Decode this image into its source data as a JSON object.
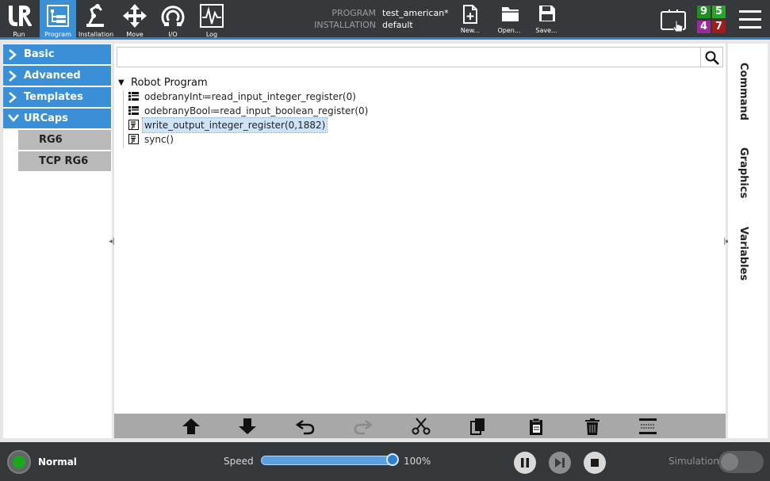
{
  "topbar": {
    "nav": [
      {
        "id": "run",
        "label": "Run",
        "icon": "ur-logo-icon",
        "active": false
      },
      {
        "id": "program",
        "label": "Program",
        "icon": "program-tree-icon",
        "active": true
      },
      {
        "id": "installation",
        "label": "Installation",
        "icon": "robot-arm-icon",
        "active": false
      },
      {
        "id": "move",
        "label": "Move",
        "icon": "move-arrows-icon",
        "active": false
      },
      {
        "id": "io",
        "label": "I/O",
        "icon": "io-dial-icon",
        "active": false
      },
      {
        "id": "log",
        "label": "Log",
        "icon": "log-chart-icon",
        "active": false
      }
    ],
    "program_label": "PROGRAM",
    "program_value": "test_american*",
    "installation_label": "INSTALLATION",
    "installation_value": "default",
    "file_buttons": [
      {
        "id": "new",
        "label": "New...",
        "icon": "new-file-icon"
      },
      {
        "id": "open",
        "label": "Open...",
        "icon": "open-folder-icon"
      },
      {
        "id": "save",
        "label": "Save...",
        "icon": "save-disk-icon"
      }
    ],
    "counters": [
      {
        "value": "9",
        "color": "#1f8f1f"
      },
      {
        "value": "5",
        "color": "#2aa52a"
      },
      {
        "value": "4",
        "color": "#9b2b9b"
      },
      {
        "value": "7",
        "color": "#a51a1a"
      }
    ]
  },
  "sidebar": {
    "categories": [
      {
        "label": "Basic",
        "expanded": false
      },
      {
        "label": "Advanced",
        "expanded": false
      },
      {
        "label": "Templates",
        "expanded": false
      },
      {
        "label": "URCaps",
        "expanded": true
      }
    ],
    "subitems": [
      {
        "label": "RG6"
      },
      {
        "label": "TCP RG6"
      }
    ]
  },
  "program": {
    "search_placeholder": "",
    "root_label": "Robot Program",
    "nodes": [
      {
        "text": "odebranyInt≔read_input_integer_register(0)",
        "icon": "assignment-icon",
        "selected": false
      },
      {
        "text": "odebranyBool≔read_input_boolean_register(0)",
        "icon": "assignment-icon",
        "selected": false
      },
      {
        "text": "write_output_integer_register(0,1882)",
        "icon": "script-icon",
        "selected": true
      },
      {
        "text": "sync()",
        "icon": "script-icon",
        "selected": false
      }
    ]
  },
  "toolbar": {
    "tools": [
      {
        "id": "move-up",
        "icon": "move-up-icon",
        "enabled": true
      },
      {
        "id": "move-down",
        "icon": "move-down-icon",
        "enabled": true
      },
      {
        "id": "undo",
        "icon": "undo-icon",
        "enabled": true
      },
      {
        "id": "redo",
        "icon": "redo-icon",
        "enabled": false
      },
      {
        "id": "cut",
        "icon": "cut-icon",
        "enabled": true
      },
      {
        "id": "copy",
        "icon": "copy-icon",
        "enabled": true
      },
      {
        "id": "paste",
        "icon": "paste-icon",
        "enabled": true
      },
      {
        "id": "delete",
        "icon": "trash-icon",
        "enabled": true
      },
      {
        "id": "suppress",
        "icon": "suppress-icon",
        "enabled": true
      }
    ]
  },
  "right_tabs": [
    "Command",
    "Graphics",
    "Variables"
  ],
  "footer": {
    "status": "Normal",
    "status_color": "#19a819",
    "speed_label": "Speed",
    "speed_value": "100%",
    "speed_fraction": 1.0,
    "simulation_label": "Simulation",
    "simulation_on": false
  }
}
